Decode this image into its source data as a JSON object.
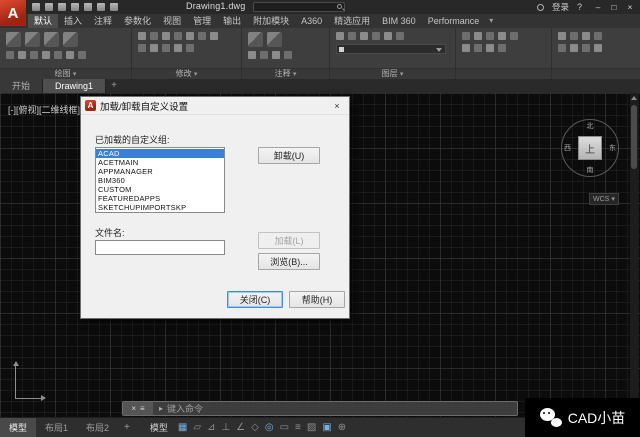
{
  "icons": {
    "close": "×",
    "customize": "≡",
    "prompt_caret": "▸",
    "caret_down": "▾",
    "help": "?"
  },
  "titlebar": {
    "title": "Drawing1.dwg",
    "signin": "登录",
    "window_controls": {
      "minimize": "–",
      "maximize": "□",
      "close": "×"
    }
  },
  "ribbon": {
    "tabs": [
      {
        "label": "默认"
      },
      {
        "label": "插入"
      },
      {
        "label": "注释"
      },
      {
        "label": "参数化"
      },
      {
        "label": "视图"
      },
      {
        "label": "管理"
      },
      {
        "label": "输出"
      },
      {
        "label": "附加模块"
      },
      {
        "label": "A360"
      },
      {
        "label": "精选应用"
      },
      {
        "label": "BIM 360"
      },
      {
        "label": "Performance"
      }
    ],
    "active_tab": "默认",
    "panels": [
      {
        "label": "绘图"
      },
      {
        "label": "修改"
      },
      {
        "label": "注释"
      },
      {
        "label": "图层"
      },
      {
        "label": ""
      },
      {
        "label": ""
      }
    ]
  },
  "file_tabs": {
    "start": "开始",
    "drawing": "Drawing1",
    "add": "+"
  },
  "viewport": {
    "controls": "[-][俯视][二维线框]"
  },
  "viewcube": {
    "north": "北",
    "south": "南",
    "east": "东",
    "west": "西",
    "top": "上",
    "wcs": "WCS"
  },
  "dialog": {
    "title": "加载/卸载自定义设置",
    "groups_label": "已加载的自定义组:",
    "list": [
      "ACAD",
      "ACETMAIN",
      "APPMANAGER",
      "BIM360",
      "CUSTOM",
      "FEATUREDAPPS",
      "SKETCHUPIMPORTSKP"
    ],
    "selected_index": 0,
    "unload": "卸载(U)",
    "filename_label": "文件名:",
    "filename_value": "",
    "load": "加载(L)",
    "browse": "浏览(B)...",
    "close_btn": "关闭(C)",
    "help": "帮助(H)"
  },
  "command_line": {
    "prompt": "键入命令"
  },
  "status_bar": {
    "layout_tabs": [
      "模型",
      "布局1",
      "布局2"
    ],
    "add_layout": "+",
    "model_label": "模型",
    "icons": [
      {
        "glyph": "▦"
      },
      {
        "glyph": "▱"
      },
      {
        "glyph": "⊿"
      },
      {
        "glyph": "⊥"
      },
      {
        "glyph": "∠"
      },
      {
        "glyph": "◇"
      },
      {
        "glyph": "◎"
      },
      {
        "glyph": "▭"
      },
      {
        "glyph": "≡"
      },
      {
        "glyph": "▨"
      },
      {
        "glyph": "▣"
      },
      {
        "glyph": "⊕"
      }
    ]
  },
  "watermark": {
    "text": "CAD小苗"
  }
}
